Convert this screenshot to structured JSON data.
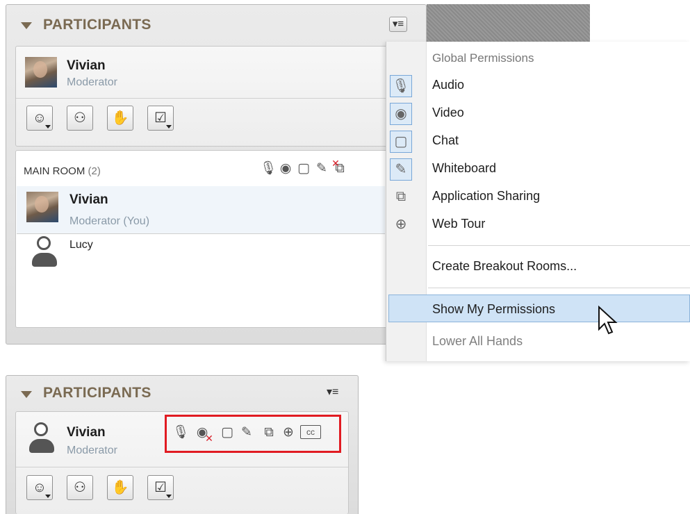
{
  "top_panel": {
    "title": "PARTICIPANTS",
    "menu_icon": "list-menu-icon",
    "user": {
      "name": "Vivian",
      "role": "Moderator"
    },
    "toolbar": [
      {
        "icon": "emoticon-icon",
        "glyph": "☺",
        "has_caret": true
      },
      {
        "icon": "step-away-icon",
        "glyph": "⚇",
        "has_caret": false
      },
      {
        "icon": "raise-hand-icon",
        "glyph": "✋",
        "has_caret": false
      },
      {
        "icon": "polling-icon",
        "glyph": "☑",
        "has_caret": true
      }
    ],
    "room": {
      "label": "MAIN ROOM",
      "count": "(2)",
      "participants": [
        {
          "name": "Vivian",
          "role": "Moderator (You)"
        },
        {
          "name": "Lucy",
          "role": ""
        }
      ]
    }
  },
  "context_menu": {
    "header": "Global Permissions",
    "items": [
      {
        "label": "Audio",
        "icon": "microphone-icon",
        "glyph": "🎙",
        "checked": true
      },
      {
        "label": "Video",
        "icon": "webcam-icon",
        "glyph": "◉",
        "checked": true
      },
      {
        "label": "Chat",
        "icon": "chat-bubble-icon",
        "glyph": "▢",
        "checked": true
      },
      {
        "label": "Whiteboard",
        "icon": "pencil-icon",
        "glyph": "✎",
        "checked": true
      },
      {
        "label": "Application Sharing",
        "icon": "app-share-icon",
        "glyph": "⧉",
        "checked": false
      },
      {
        "label": "Web Tour",
        "icon": "globe-icon",
        "glyph": "⊕",
        "checked": false
      }
    ],
    "create_breakout": "Create Breakout Rooms...",
    "show_permissions": "Show My Permissions",
    "lower_hands": "Lower All Hands"
  },
  "bottom_panel": {
    "title": "PARTICIPANTS",
    "user": {
      "name": "Vivian",
      "role": "Moderator"
    },
    "highlight_color": "#e11b22"
  },
  "colors": {
    "title_brown": "#7a6a52",
    "menu_hover": "#cfe3f6",
    "check_border": "#78a7d8"
  }
}
